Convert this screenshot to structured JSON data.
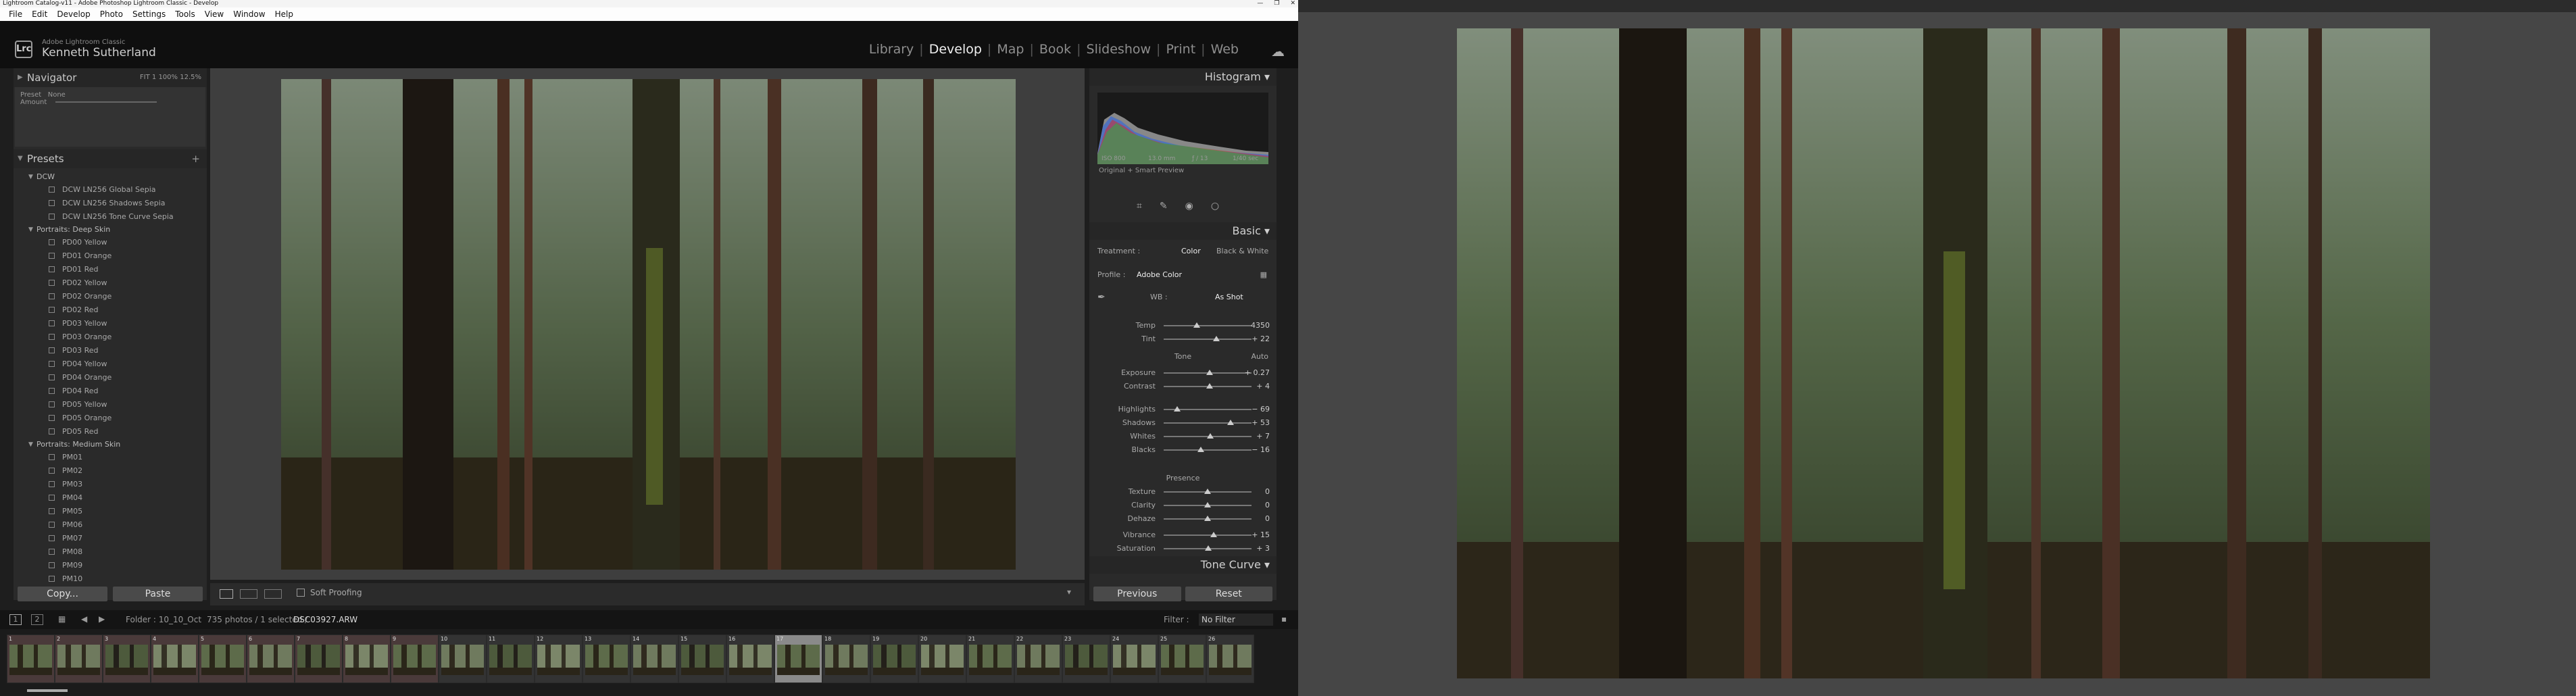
{
  "window_title": "Lightroom Catalog-v11 - Adobe Photoshop Lightroom Classic - Develop",
  "window_controls": [
    "—",
    "❐",
    "✕"
  ],
  "menu": [
    "File",
    "Edit",
    "Develop",
    "Photo",
    "Settings",
    "Tools",
    "View",
    "Window",
    "Help"
  ],
  "identity": {
    "product": "Adobe Lightroom Classic",
    "user": "Kenneth Sutherland",
    "logo": "Lrc"
  },
  "modules": [
    "Library",
    "Develop",
    "Map",
    "Book",
    "Slideshow",
    "Print",
    "Web"
  ],
  "active_module": "Develop",
  "navigator": {
    "title": "Navigator",
    "zoom_options": [
      "FIT",
      "1",
      "100%",
      "12.5%"
    ],
    "preset_label": "Preset",
    "amount_label": "Amount",
    "preset_value": "None"
  },
  "presets": {
    "title": "Presets",
    "groups": [
      {
        "name": "DCW",
        "items": [
          "DCW LN256 Global Sepia",
          "DCW LN256 Shadows Sepia",
          "DCW LN256 Tone Curve Sepia"
        ]
      },
      {
        "name": "Portraits: Deep Skin",
        "items": [
          "PD00 Yellow",
          "PD01 Orange",
          "PD01 Red",
          "PD02 Yellow",
          "PD02 Orange",
          "PD02 Red",
          "PD03 Yellow",
          "PD03 Orange",
          "PD03 Red",
          "PD04 Yellow",
          "PD04 Orange",
          "PD04 Red",
          "PD05 Yellow",
          "PD05 Orange",
          "PD05 Red"
        ]
      },
      {
        "name": "Portraits: Medium Skin",
        "items": [
          "PM01",
          "PM02",
          "PM03",
          "PM04",
          "PM05",
          "PM06",
          "PM07",
          "PM08",
          "PM09",
          "PM10"
        ]
      }
    ]
  },
  "left_buttons": {
    "copy": "Copy...",
    "paste": "Paste"
  },
  "toolbar": {
    "soft_proofing": "Soft Proofing"
  },
  "histogram": {
    "title": "Histogram",
    "iso": "ISO 800",
    "focal": "13.0 mm",
    "aperture": "ƒ / 13",
    "shutter": "1/40 sec",
    "preview": "Original + Smart Preview"
  },
  "basic": {
    "title": "Basic",
    "treatment_label": "Treatment :",
    "treatment_color": "Color",
    "treatment_bw": "Black & White",
    "profile_label": "Profile :",
    "profile_value": "Adobe Color",
    "wb_label": "WB :",
    "wb_value": "As Shot",
    "temp": {
      "label": "Temp",
      "value": "4350",
      "pos": 0.38
    },
    "tint": {
      "label": "Tint",
      "value": "+ 22",
      "pos": 0.6
    },
    "tone_label": "Tone",
    "auto_label": "Auto",
    "sliders": [
      {
        "label": "Exposure",
        "value": "+ 0.27",
        "pos": 0.52
      },
      {
        "label": "Contrast",
        "value": "+ 4",
        "pos": 0.52
      },
      {
        "label": "Highlights",
        "value": "− 69",
        "pos": 0.15
      },
      {
        "label": "Shadows",
        "value": "+ 53",
        "pos": 0.76
      },
      {
        "label": "Whites",
        "value": "+ 7",
        "pos": 0.53
      },
      {
        "label": "Blacks",
        "value": "− 16",
        "pos": 0.42
      }
    ],
    "presence_label": "Presence",
    "presence": [
      {
        "label": "Texture",
        "value": "0",
        "pos": 0.5
      },
      {
        "label": "Clarity",
        "value": "0",
        "pos": 0.5
      },
      {
        "label": "Dehaze",
        "value": "0",
        "pos": 0.5
      },
      {
        "label": "Vibrance",
        "value": "+ 15",
        "pos": 0.57
      },
      {
        "label": "Saturation",
        "value": "+ 3",
        "pos": 0.51
      }
    ]
  },
  "tone_curve_title": "Tone Curve",
  "right_buttons": {
    "previous": "Previous",
    "reset": "Reset"
  },
  "filmstrip": {
    "folder": "Folder : 10_10_Oct",
    "count": "735 photos / 1 selected /",
    "filename": "DSC03927.ARW",
    "filter_label": "Filter :",
    "filter_value": "No Filter",
    "page_buttons": [
      "1",
      "2"
    ],
    "thumb_numbers": [
      "1",
      "2",
      "3",
      "4",
      "5",
      "6",
      "7",
      "8",
      "9",
      "10",
      "11",
      "12",
      "13",
      "14",
      "15",
      "16",
      "17",
      "18",
      "19",
      "20",
      "21",
      "22",
      "23",
      "24",
      "25",
      "26"
    ],
    "selected_index": 16
  },
  "colors": {
    "accent": "#f0f0f0",
    "panel": "#2a2a2a",
    "center": "#3e3e3e"
  },
  "icons": [
    "lrc-logo",
    "cloud-icon",
    "spot-removal-icon",
    "brush-icon",
    "eye-icon",
    "circle-icon",
    "dropper-icon",
    "loupe-icon",
    "compare-icon",
    "grid-icon"
  ]
}
